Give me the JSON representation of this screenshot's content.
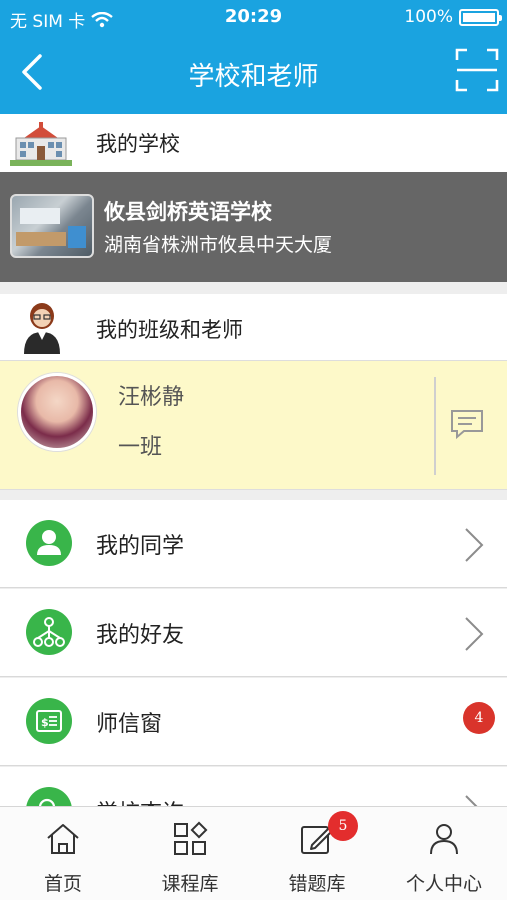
{
  "status_bar": {
    "carrier": "无 SIM 卡",
    "time": "20:29",
    "battery": "100%"
  },
  "nav": {
    "title": "学校和老师",
    "back_icon": "chevron-left-icon",
    "scan_icon": "scan-icon"
  },
  "school_section": {
    "header": "我的学校",
    "name": "攸县剑桥英语学校",
    "address": "湖南省株洲市攸县中天大厦"
  },
  "teacher_section": {
    "header": "我的班级和老师",
    "teacher_name": "汪彬静",
    "class_name": "一班"
  },
  "menu": [
    {
      "label": "我的同学",
      "icon": "person-icon",
      "badge": null
    },
    {
      "label": "我的好友",
      "icon": "network-icon",
      "badge": null
    },
    {
      "label": "师信窗",
      "icon": "letter-icon",
      "badge": "4"
    },
    {
      "label": "学校查询",
      "icon": "search-icon",
      "badge": null
    }
  ],
  "tabbar": [
    {
      "label": "首页",
      "icon": "home-icon"
    },
    {
      "label": "课程库",
      "icon": "grid-icon"
    },
    {
      "label": "错题库",
      "icon": "edit-icon",
      "badge": "5"
    },
    {
      "label": "个人中心",
      "icon": "user-icon"
    }
  ],
  "colors": {
    "primary": "#1aa3e0",
    "green": "#39b54a",
    "badge_red": "#d9342b",
    "teacher_bg": "#fdf9c9",
    "school_bg": "#666666"
  }
}
